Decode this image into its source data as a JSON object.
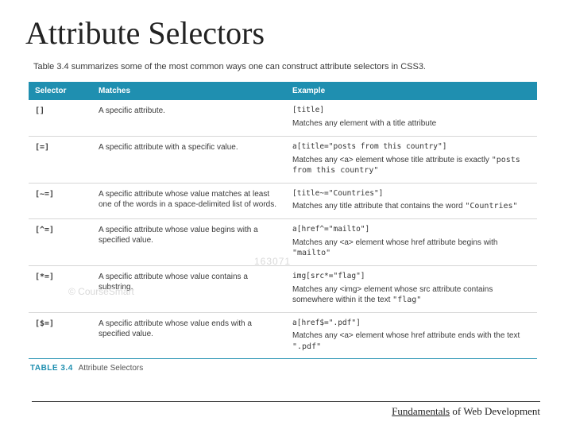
{
  "title": "Attribute Selectors",
  "intro": "Table 3.4 summarizes some of the most common ways one can construct attribute selectors in CSS3.",
  "headers": {
    "selector": "Selector",
    "matches": "Matches",
    "example": "Example"
  },
  "rows": [
    {
      "selector": "[]",
      "matches": "A specific attribute.",
      "example_code": "[title]",
      "example_desc": "Matches any element with a title attribute"
    },
    {
      "selector": "[=]",
      "matches": "A specific attribute with a specific value.",
      "example_code": "a[title=\"posts from this country\"]",
      "example_desc_pre": "Matches any <a> element whose title attribute is exactly ",
      "example_desc_mono": "\"posts from this country\""
    },
    {
      "selector": "[~=]",
      "matches": "A specific attribute whose value matches at least one of the words in a space-delimited list of words.",
      "example_code": "[title~=\"Countries\"]",
      "example_desc_pre": "Matches any title attribute that contains the word ",
      "example_desc_mono": "\"Countries\""
    },
    {
      "selector": "[^=]",
      "matches": "A specific attribute whose value begins with a specified value.",
      "example_code": "a[href^=\"mailto\"]",
      "example_desc_pre": "Matches any <a> element whose href attribute begins with ",
      "example_desc_mono": "\"mailto\""
    },
    {
      "selector": "[*=]",
      "matches": "A specific attribute whose value contains a substring.",
      "example_code": "img[src*=\"flag\"]",
      "example_desc_pre": "Matches any <img> element whose src attribute contains somewhere within it the text ",
      "example_desc_mono": "\"flag\""
    },
    {
      "selector": "[$=]",
      "matches": "A specific attribute whose value ends with a specified value.",
      "example_code": "a[href$=\".pdf\"]",
      "example_desc_pre": "Matches any <a> element whose href attribute ends with the text ",
      "example_desc_mono": "\".pdf\""
    }
  ],
  "caption_num": "TABLE 3.4",
  "caption_text": "Attribute Selectors",
  "watermark1": "163071",
  "watermark2": "© CourseSmart",
  "footer": {
    "fundamentals": "Fundamentals",
    "rest": " of Web Development"
  }
}
